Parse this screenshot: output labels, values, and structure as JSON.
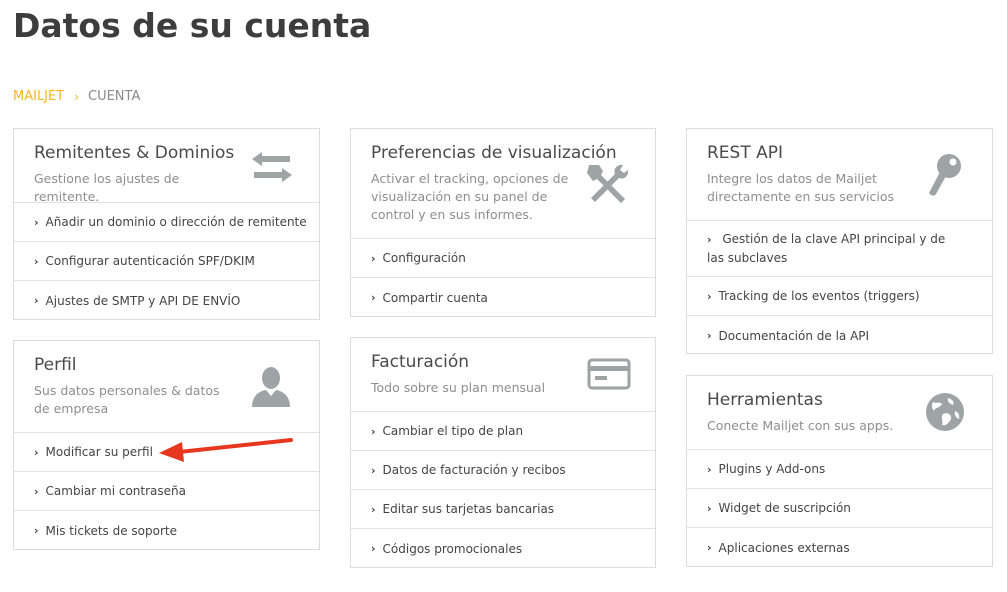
{
  "page": {
    "title": "Datos de su cuenta"
  },
  "breadcrumb": {
    "root": "MAILJET",
    "current": "CUENTA"
  },
  "cards": {
    "senders": {
      "title": "Remitentes & Dominios",
      "desc": "Gestione los ajustes de remitente.",
      "icon": "arrows-exchange-icon",
      "items": [
        "Añadir un dominio o dirección de remitente",
        "Configurar autenticación SPF/DKIM",
        "Ajustes de SMTP y API DE ENVÍO"
      ]
    },
    "profile": {
      "title": "Perfil",
      "desc": "Sus datos personales & datos de empresa",
      "icon": "user-icon",
      "items": [
        "Modificar su perfil",
        "Cambiar mi contraseña",
        "Mis tickets de soporte"
      ]
    },
    "display": {
      "title": "Preferencias de visualización",
      "desc": "Activar el tracking, opciones de visualización en su panel de control y en sus informes.",
      "icon": "tools-icon",
      "items": [
        "Configuración",
        "Compartir cuenta"
      ]
    },
    "billing": {
      "title": "Facturación",
      "desc": "Todo sobre su plan mensual",
      "icon": "credit-card-icon",
      "items": [
        "Cambiar el tipo de plan",
        "Datos de facturación y recibos",
        "Editar sus tarjetas bancarias",
        "Códigos promocionales"
      ]
    },
    "restapi": {
      "title": "REST API",
      "desc": "Integre los datos de Mailjet directamente en sus servicios",
      "icon": "key-icon",
      "items": [
        "Gestión de la clave API principal y de las subclaves",
        "Tracking de los eventos (triggers)",
        "Documentación de la API"
      ]
    },
    "tools": {
      "title": "Herramientas",
      "desc": "Conecte Mailjet con sus apps.",
      "icon": "globe-icon",
      "items": [
        "Plugins y Add-ons",
        "Widget de suscripción",
        "Aplicaciones externas"
      ]
    }
  },
  "annotation": {
    "arrow_color": "#e8371f"
  },
  "colors": {
    "accent": "#f5b61e",
    "icon": "#9ea3a6"
  }
}
